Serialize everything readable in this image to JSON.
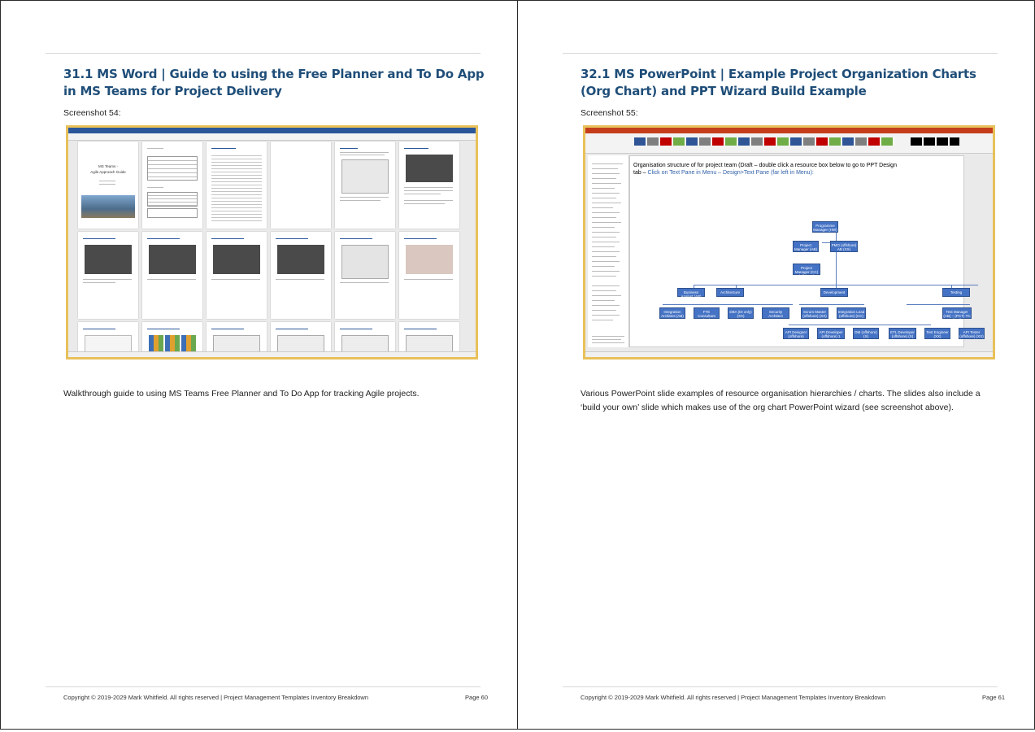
{
  "left_page": {
    "heading": "31.1  MS Word | Guide to using the Free Planner and To Do App in MS Teams for Project Delivery",
    "caption": "Screenshot 54:",
    "description": "Walkthrough guide to using MS Teams Free Planner and To Do App for tracking Agile projects.",
    "footer": "Copyright © 2019-2029 Mark Whitfield. All rights reserved | Project Management Templates Inventory Breakdown",
    "page_number": "Page 60",
    "screenshot": {
      "cover_title": "MS Teams -",
      "cover_subtitle": "Agile Approach Guide"
    }
  },
  "right_page": {
    "heading": "32.1  MS PowerPoint | Example Project Organization Charts (Org Chart) and PPT Wizard Build Example",
    "caption": "Screenshot 55:",
    "description": "Various PowerPoint slide examples of resource organisation hierarchies / charts. The slides also include a ‘build your own’ slide which makes use of the org chart PowerPoint wizard (see screenshot above).",
    "footer": "Copyright © 2019-2029 Mark Whitfield. All rights reserved | Project Management Templates Inventory Breakdown",
    "page_number": "Page 61",
    "screenshot": {
      "slide_text_1": "Organisation structure of for project team (Draft – double click a resource box below to go to PPT Design",
      "slide_text_2": "tab – ",
      "slide_link": "Click on Text Pane in Menu – Design>Text Pane (far left in Menu):",
      "boxes": {
        "programme": "Programme Manager (HW)",
        "pm": "Project Manager (AB)",
        "pmo": "PMO (offshore) AB (XX)",
        "pm_cc": "Project Manager (CC) (offshore)",
        "ba": "Business Analyst (AB)",
        "arch": "Architecture",
        "dev": "Development",
        "test": "Testing",
        "uk_off": "UK / Offshore",
        "int_arch": "Integration Architect (AB)",
        "fte": "FTE Consultant (PT)",
        "dba": "DBA (DI only) (XX)",
        "sec": "Security Architect Assessment (PT)",
        "scrum": "Scrum Master (offshore) (XX)",
        "int_lead": "Integration Lead (offshore) (CC)",
        "test_mgr": "Test Manager (AB) – (PCT) TC (lead)",
        "api_designer": "API Designer (offshore)",
        "api_dev": "API Developer (offshore) 1 (XX)",
        "dm_dev": "DM (offshore) (X)",
        "etl": "ETL Developer (offshore) (X)",
        "test_eng": "Test Engineer (XX)",
        "api_tester": "API Tester (offshore) (XX)",
        "tbc": "TBC"
      }
    }
  }
}
